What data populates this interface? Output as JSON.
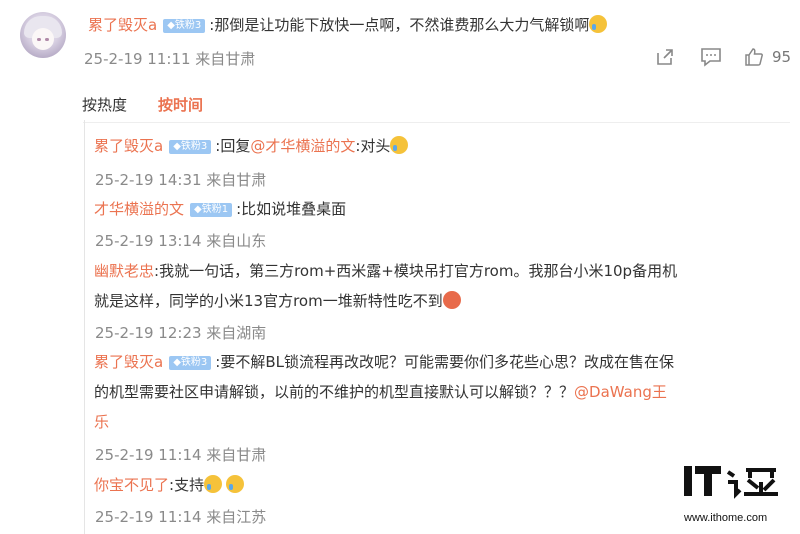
{
  "main_comment": {
    "username": "累了毁灭a",
    "badge": "铁粉3",
    "text": ":那倒是让功能下放快一点啊，不然谁费那么大力气解锁啊",
    "time": "25-2-19 11:11 来自甘肃",
    "like_count": "95",
    "icons": [
      "share-icon",
      "comment-icon",
      "like-icon"
    ]
  },
  "sort_tabs": [
    {
      "label": "按热度",
      "active": false
    },
    {
      "label": "按时间",
      "active": true
    }
  ],
  "replies": [
    {
      "username": "累了毁灭a",
      "badge": "铁粉3",
      "prefix": ":回复",
      "mention": "@才华横溢的文",
      "text": ":对头",
      "time": "25-2-19 14:31 来自甘肃"
    },
    {
      "username": "才华横溢的文",
      "badge": "铁粉1",
      "text": ":比如说堆叠桌面",
      "time": "25-2-19 13:14 来自山东"
    },
    {
      "username": "幽默老忠",
      "text_line1": ":我就一句话，第三方rom+西米露+模块吊打官方rom。我那台小米10p备用机",
      "text_line2": "就是这样，同学的小米13官方rom一堆新特性吃不到",
      "time": "25-2-19 12:23 来自湖南"
    },
    {
      "username": "累了毁灭a",
      "badge": "铁粉3",
      "text_line1": ":要不解BL锁流程再改改呢？可能需要你们多花些心思？改成在售在保",
      "text_line2": "的机型需要社区申请解锁，以前的不维护的机型直接默认可以解锁？？？",
      "mention": "@DaWang王",
      "text_line3": "乐",
      "time": "25-2-19 11:14 来自甘肃"
    },
    {
      "username": "你宝不见了",
      "text": ":支持",
      "time": "25-2-19 11:14 来自江苏"
    }
  ],
  "watermark": {
    "logo": "IT之家",
    "url": "www.ithome.com"
  }
}
